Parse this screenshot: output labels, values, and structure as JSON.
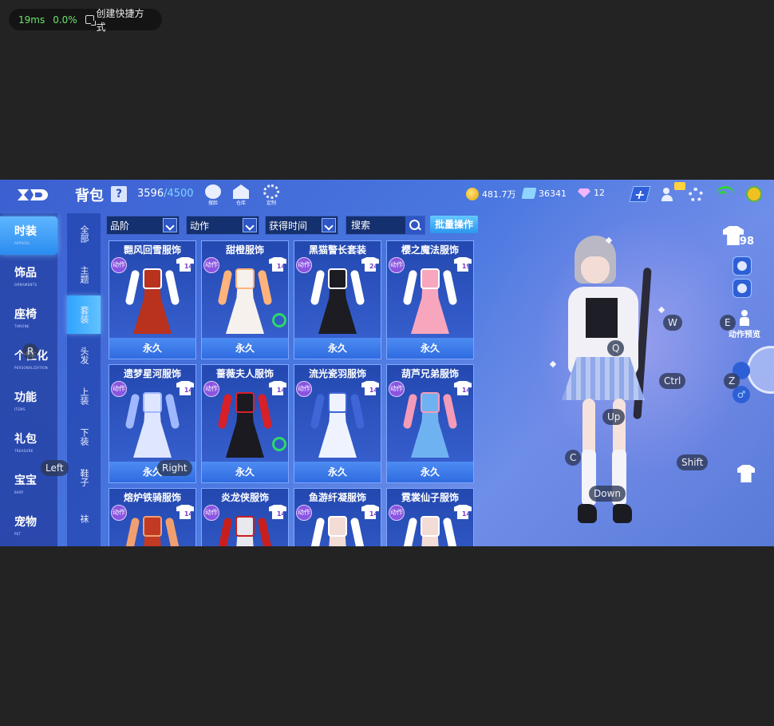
{
  "status_pill": {
    "latency": "19ms",
    "loss": "0.0%",
    "shortcut_label": "创建快捷方式"
  },
  "header": {
    "title": "背包",
    "help": "?",
    "capacity_used": "3596",
    "capacity_max": "/4500",
    "icons": [
      {
        "name": "exchange-icon",
        "label": "搜脸"
      },
      {
        "name": "warehouse-icon",
        "label": "仓库"
      },
      {
        "name": "custom-icon",
        "label": "定制"
      }
    ],
    "coins": "481.7万",
    "tickets": "36341",
    "diamonds": "12"
  },
  "left_nav": [
    {
      "zh": "时装",
      "en": "APPAREL",
      "active": true
    },
    {
      "zh": "饰品",
      "en": "ORNAMENTS",
      "active": false
    },
    {
      "zh": "座椅",
      "en": "THRONE",
      "active": false
    },
    {
      "zh": "个性化",
      "en": "PERSONALIZATION",
      "active": false
    },
    {
      "zh": "功能",
      "en": "ITEMS",
      "active": false
    },
    {
      "zh": "礼包",
      "en": "TREASURE",
      "active": false
    },
    {
      "zh": "宝宝",
      "en": "BABY",
      "active": false
    },
    {
      "zh": "宠物",
      "en": "PET",
      "active": false
    }
  ],
  "sub_nav": [
    {
      "label": "全部",
      "active": false
    },
    {
      "label": "主题",
      "active": false
    },
    {
      "label": "套装",
      "active": true
    },
    {
      "label": "头发",
      "active": false
    },
    {
      "label": "上装",
      "active": false
    },
    {
      "label": "下装",
      "active": false
    },
    {
      "label": "鞋子",
      "active": false
    },
    {
      "label": "袜",
      "active": false
    }
  ],
  "filters": {
    "grade": "品阶",
    "action": "动作",
    "time": "获得时间",
    "search_placeholder": "搜索",
    "batch": "批量操作"
  },
  "items": [
    {
      "name": "翾风回雪服饰",
      "tag": "动作",
      "level": "14",
      "duration": "永久",
      "color": "#b8321e",
      "trim": "#ffffff",
      "equipped": false
    },
    {
      "name": "甜橙服饰",
      "tag": "动作",
      "level": "14",
      "duration": "永久",
      "color": "#f7f1ee",
      "trim": "#ffb37a",
      "equipped": true
    },
    {
      "name": "黑猫警长套装",
      "tag": "动作",
      "level": "24",
      "duration": "永久",
      "color": "#1c1c22",
      "trim": "#ffffff",
      "equipped": false
    },
    {
      "name": "樱之魔法服饰",
      "tag": "动作",
      "level": "19",
      "duration": "永久",
      "color": "#f7a6be",
      "trim": "#ffffff",
      "equipped": false
    },
    {
      "name": "遗梦星河服饰",
      "tag": "动作",
      "level": "14",
      "duration": "永久",
      "color": "#dfe6ff",
      "trim": "#9fb8ff",
      "equipped": false
    },
    {
      "name": "蔷薇夫人服饰",
      "tag": "动作",
      "level": "14",
      "duration": "永久",
      "color": "#1a1a20",
      "trim": "#d8202a",
      "equipped": true
    },
    {
      "name": "流光瓷羽服饰",
      "tag": "动作",
      "level": "14",
      "duration": "永久",
      "color": "#eef3ff",
      "trim": "#3e66d6",
      "equipped": false
    },
    {
      "name": "葫芦兄弟服饰",
      "tag": "动作",
      "level": "14",
      "duration": "永久",
      "color": "#6fb2f2",
      "trim": "#f49bb8",
      "equipped": false
    },
    {
      "name": "熔炉铁骑服饰",
      "tag": "动作",
      "level": "14",
      "duration": "",
      "color": "#c23a24",
      "trim": "#f0a070",
      "equipped": false
    },
    {
      "name": "炎龙侠服饰",
      "tag": "动作",
      "level": "14",
      "duration": "",
      "color": "#e8e8ee",
      "trim": "#c81e1e",
      "equipped": false
    },
    {
      "name": "鱼游纤凝服饰",
      "tag": "动作",
      "level": "14",
      "duration": "",
      "color": "#f4dcd6",
      "trim": "#ffffff",
      "equipped": false
    },
    {
      "name": "霓裳仙子服饰",
      "tag": "动作",
      "level": "14",
      "duration": "",
      "color": "#f4dcd6",
      "trim": "#ffffff",
      "equipped": false
    }
  ],
  "right_panel": {
    "outfit_count": "98",
    "action_preview": "动作预览",
    "gender_symbol": "♂"
  },
  "keys": {
    "R": "R",
    "Left": "Left",
    "Right": "Right",
    "W": "W",
    "E": "E",
    "Q": "Q",
    "Ctrl": "Ctrl",
    "Z": "Z",
    "Up": "Up",
    "C": "C",
    "Shift": "Shift",
    "Down": "Down"
  }
}
